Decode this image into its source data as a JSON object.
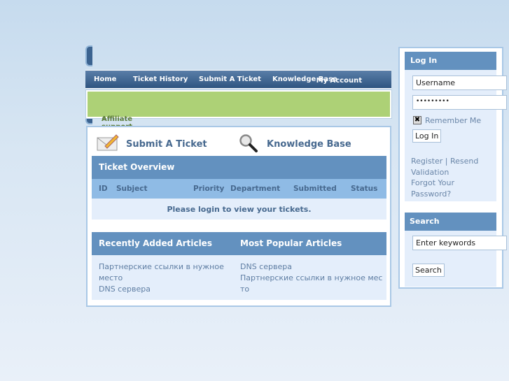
{
  "nav": {
    "items": [
      "Home",
      "Ticket History",
      "Submit A Ticket",
      "Knowledge Base",
      "My Account"
    ]
  },
  "breadcrumb": {
    "sep": "»",
    "label": "Affiliate support desk"
  },
  "quick_links": {
    "submit": "Submit A Ticket",
    "kb": "Knowledge Base"
  },
  "tickets": {
    "title": "Ticket Overview",
    "columns": [
      "ID",
      "Subject",
      "Priority",
      "Department",
      "Submitted",
      "Status"
    ],
    "message": "Please login to view your tickets."
  },
  "articles": {
    "recent_title": "Recently Added Articles",
    "popular_title": "Most Popular Articles",
    "recent": [
      "Партнерские ссылки в нужное место",
      "DNS сервера"
    ],
    "popular": [
      "DNS сервера",
      "Партнерские ссылки в нужное место"
    ]
  },
  "login": {
    "title": "Log In",
    "username": "Username",
    "password": "•••••••••",
    "remember": "Remember Me",
    "remember_checked": true,
    "button": "Log In",
    "register": "Register",
    "divider": "|",
    "resend": "Resend Validation",
    "forgot": "Forgot Your Password?"
  },
  "search": {
    "title": "Search",
    "placeholder": "Enter keywords",
    "button": "Search"
  },
  "colors": {
    "header": "#6391bf",
    "nav": "#2f5581",
    "breadcrumb": "#add176",
    "link": "#47698f"
  }
}
